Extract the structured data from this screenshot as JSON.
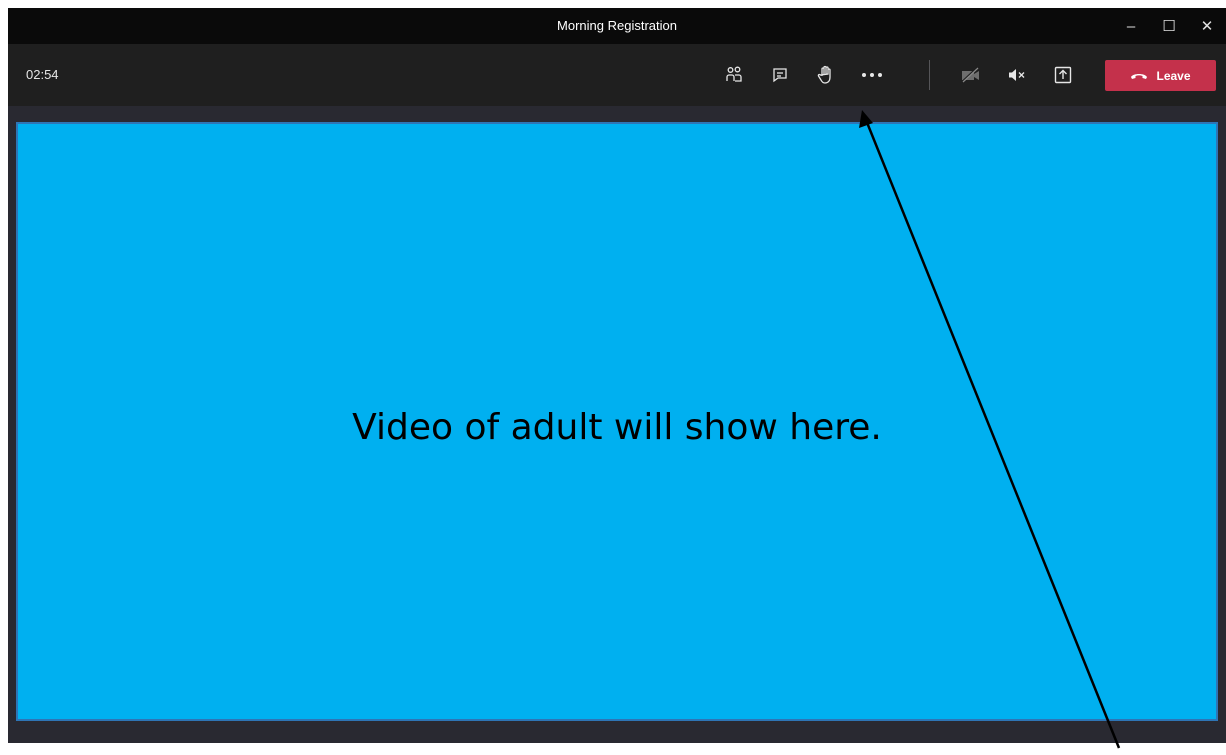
{
  "window": {
    "title": "Morning Registration",
    "controls": {
      "minimize": "–",
      "maximize": "☐",
      "close": "✕"
    }
  },
  "toolbar": {
    "timer": "02:54",
    "buttons": [
      {
        "name": "participants",
        "icon": "people-icon"
      },
      {
        "name": "chat",
        "icon": "chat-icon"
      },
      {
        "name": "raise-hand",
        "icon": "hand-icon"
      },
      {
        "name": "more-actions",
        "icon": "ellipsis-icon"
      },
      {
        "name": "camera-off",
        "icon": "camera-off-icon"
      },
      {
        "name": "mute",
        "icon": "speaker-muted-icon"
      },
      {
        "name": "share",
        "icon": "share-tray-icon"
      }
    ],
    "leave_label": "Leave"
  },
  "video": {
    "caption": "Video of adult will show here."
  },
  "colors": {
    "leave": "#c4314b",
    "video_bg": "#00b0f0",
    "video_border": "#2e75b6"
  }
}
